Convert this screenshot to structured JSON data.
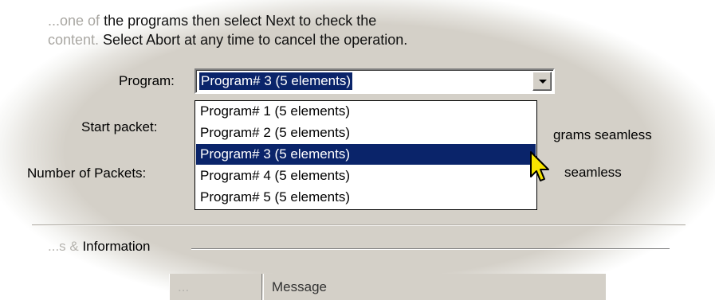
{
  "instructions": {
    "line1_faded": "...one of",
    "line1": " the programs then select Next to check the",
    "line2_faded": "content.",
    "line2": "  Select Abort at any time to cancel the operation."
  },
  "program_label": "Program:",
  "program_combo": {
    "selected": "Program# 3  (5 elements)",
    "options": [
      "Program# 1  (5 elements)",
      "Program# 2  (5 elements)",
      "Program# 3  (5 elements)",
      "Program# 4  (5 elements)",
      "Program# 5  (5 elements)"
    ],
    "highlighted_index": 2
  },
  "start_packet_label": "Start packet:",
  "num_packets_label": "Number of Packets:",
  "partial_option_1": "grams seamless",
  "partial_option_2": "seamless",
  "group_box": {
    "title_faded": "...s &",
    "title": " Information"
  },
  "columns": [
    {
      "label": "...",
      "faded": true
    },
    {
      "label": "Message",
      "faded": false
    }
  ],
  "colors": {
    "selection": "#0a246a",
    "face": "#d4d0c8"
  }
}
